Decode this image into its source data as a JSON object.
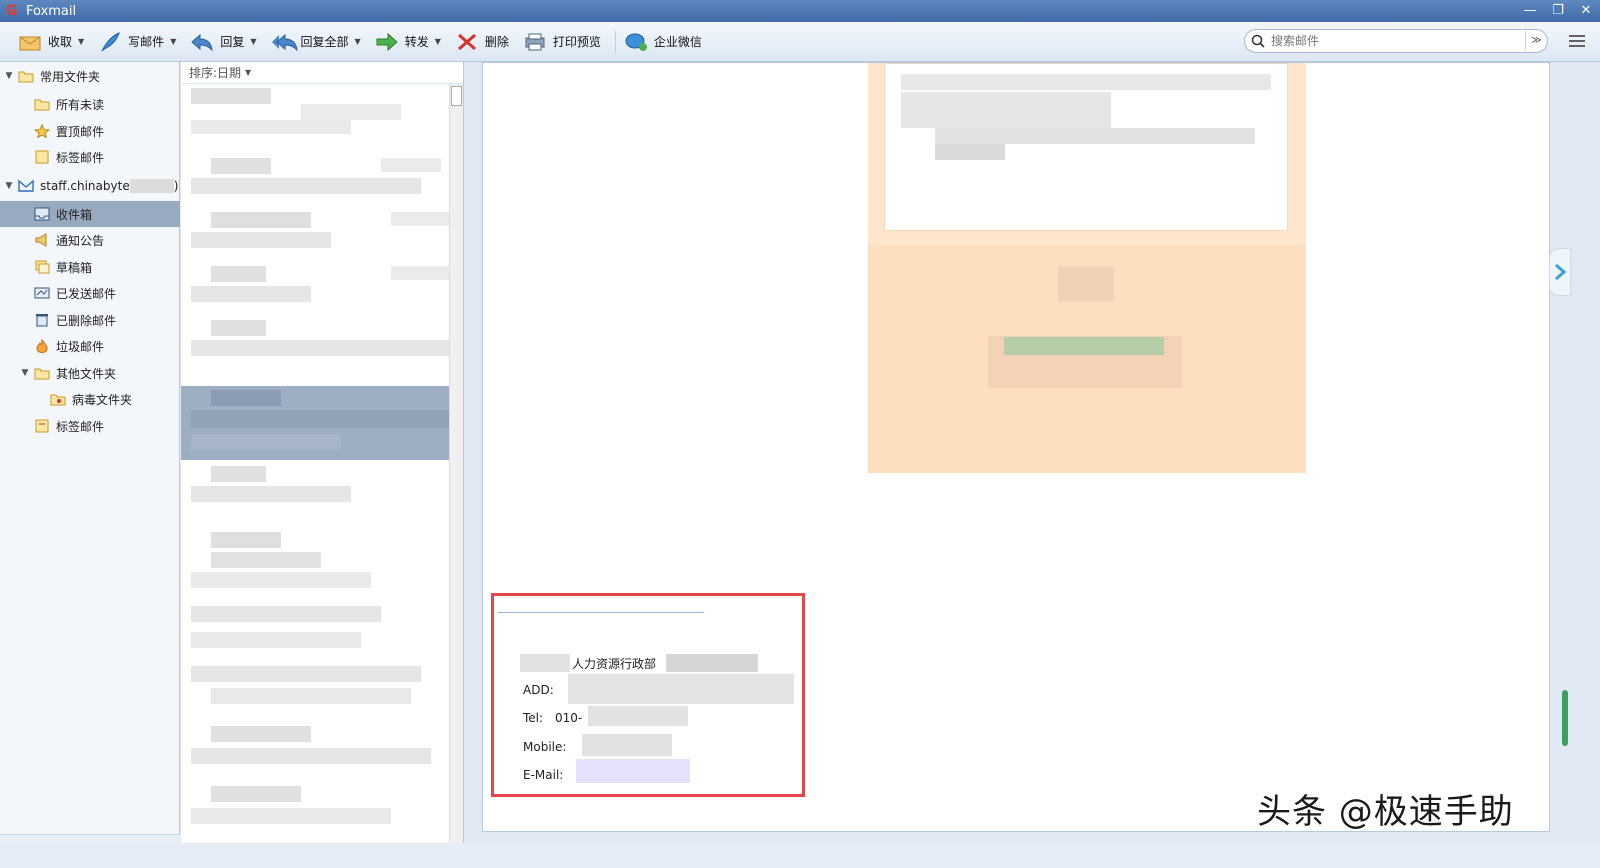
{
  "window": {
    "title": "Foxmail"
  },
  "toolbar": {
    "receive": "收取",
    "compose": "写邮件",
    "reply": "回复",
    "reply_all": "回复全部",
    "forward": "转发",
    "delete": "删除",
    "print_preview": "打印预览",
    "wechat_work": "企业微信"
  },
  "search": {
    "placeholder": "搜索邮件"
  },
  "sidebar": {
    "common_folders": "常用文件夹",
    "all_unread": "所有未读",
    "pinned": "置顶邮件",
    "tagged": "标签邮件",
    "account": "staff.chinabyte",
    "account_suffix": ")",
    "inbox": "收件箱",
    "notices": "通知公告",
    "drafts": "草稿箱",
    "sent": "已发送邮件",
    "deleted": "已删除邮件",
    "spam": "垃圾邮件",
    "other_folders": "其他文件夹",
    "virus": "病毒文件夹",
    "tagged2": "标签邮件"
  },
  "maillist": {
    "sort_label": "排序:日期"
  },
  "signature": {
    "department": "人力资源行政部",
    "add_label": "ADD:",
    "tel_label": "Tel:",
    "tel_prefix": "010-",
    "mobile_label": "Mobile:",
    "email_label": "E-Mail:"
  },
  "watermark": "头条 @极速手助",
  "colors": {
    "accent": "#3f6aa6",
    "selection": "#98aac0",
    "highlight_box": "#e2474b"
  }
}
